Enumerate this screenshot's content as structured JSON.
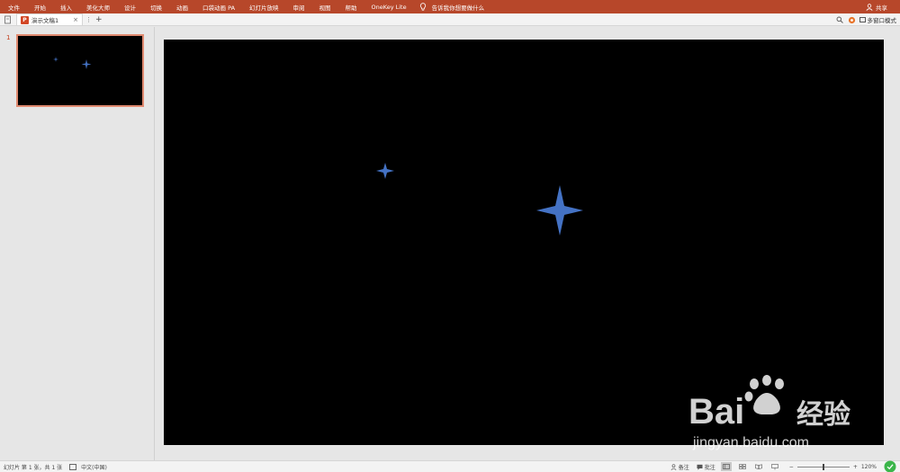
{
  "menubar": {
    "items": [
      "文件",
      "开始",
      "插入",
      "美化大师",
      "设计",
      "切换",
      "动画",
      "口袋动画 PA",
      "幻灯片放映",
      "审阅",
      "视图",
      "帮助",
      "OneKey Lite"
    ],
    "tell_me": "告诉我你想要做什么",
    "share": "共享"
  },
  "tabbar": {
    "doc_tab": "演示文稿1",
    "multi_window": "多窗口模式"
  },
  "thumbpane": {
    "slide_number": "1"
  },
  "statusbar": {
    "slide_info": "幻灯片 第 1 张，共 1 张",
    "language": "中文(中国)",
    "notes": "备注",
    "comments": "批注",
    "zoom": "120%",
    "zoom_level_fraction": 0.5
  },
  "watermark": {
    "brand": "Bai",
    "brand2": "经验",
    "url": "jingyan.baidu.com"
  },
  "colors": {
    "accent": "#b7472a",
    "star": "#4472c4",
    "slide_bg": "#000000"
  }
}
